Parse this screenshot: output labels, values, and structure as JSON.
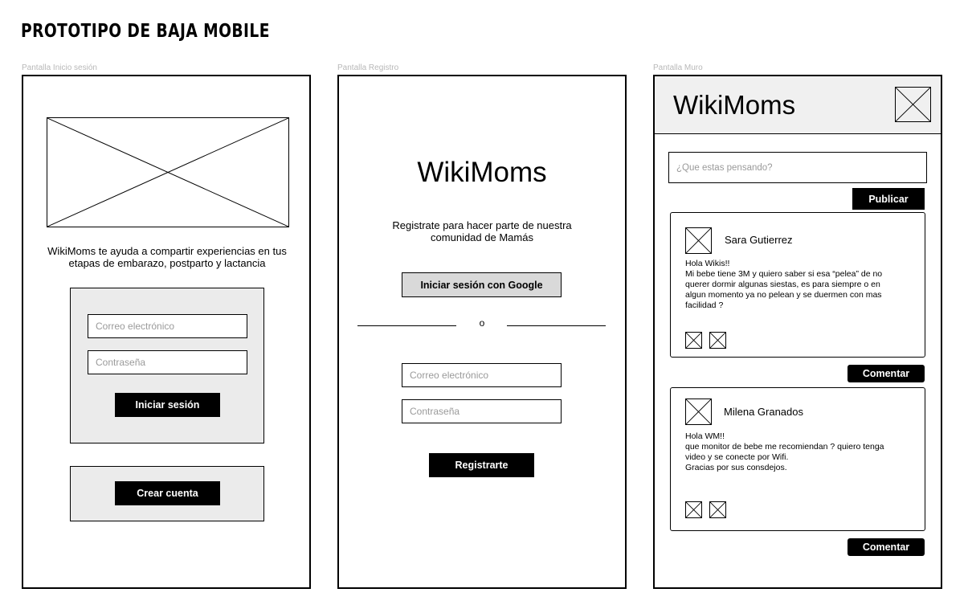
{
  "page_title": "PROTOTIPO DE BAJA MOBILE",
  "screens": {
    "login": {
      "label": "Pantalla Inicio sesión",
      "description": "WikiMoms te ayuda a compartir experiencias en tus etapas de embarazo, postparto y lactancia",
      "email_placeholder": "Correo electrónico",
      "password_placeholder": "Contraseña",
      "login_button": "Iniciar sesión",
      "create_account_button": "Crear cuenta"
    },
    "register": {
      "label": "Pantalla Registro",
      "app_name": "WikiMoms",
      "subtitle": "Registrate para hacer parte de nuestra comunidad de Mamás",
      "google_button": "Iniciar sesión con Google",
      "divider_text": "o",
      "email_placeholder": "Correo electrónico",
      "password_placeholder": "Contraseña",
      "register_button": "Registrarte"
    },
    "wall": {
      "label": "Pantalla Muro",
      "app_name": "WikiMoms",
      "post_placeholder": "¿Que estas pensando?",
      "publish_button": "Publicar",
      "posts": [
        {
          "author": "Sara Gutierrez",
          "text": "Hola Wikis!!\nMi bebe tiene 3M y quiero saber si esa “pelea” de no querer dormir algunas siestas, es para siempre o en algun momento ya no pelean y se duermen con mas facilidad ?",
          "comment_button": "Comentar"
        },
        {
          "author": "Milena Granados",
          "text": "Hola WM!!\nque monitor de bebe me recomiendan ? quiero tenga video y se conecte por Wifi.\nGracias por sus consdejos.",
          "comment_button": "Comentar"
        }
      ]
    }
  }
}
